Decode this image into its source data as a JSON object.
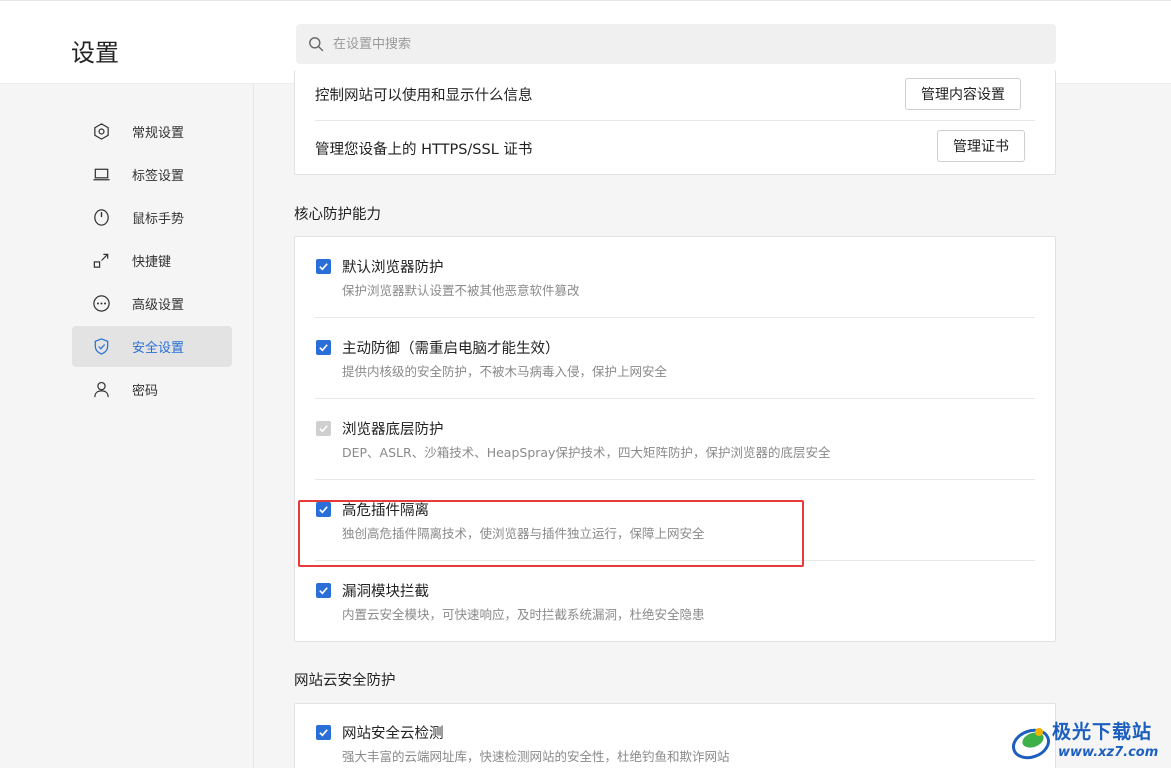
{
  "header": {
    "title": "设置",
    "search_placeholder": "在设置中搜索"
  },
  "sidebar": {
    "items": [
      {
        "label": "常规设置",
        "icon": "hexagon-icon",
        "active": false
      },
      {
        "label": "标签设置",
        "icon": "laptop-icon",
        "active": false
      },
      {
        "label": "鼠标手势",
        "icon": "mouse-icon",
        "active": false
      },
      {
        "label": "快捷键",
        "icon": "shortcut-icon",
        "active": false
      },
      {
        "label": "高级设置",
        "icon": "more-icon",
        "active": false
      },
      {
        "label": "安全设置",
        "icon": "shield-icon",
        "active": true
      },
      {
        "label": "密码",
        "icon": "person-icon",
        "active": false
      }
    ]
  },
  "top_card": {
    "rows": [
      {
        "text": "控制网站可以使用和显示什么信息",
        "button": "管理内容设置"
      },
      {
        "text": "管理您设备上的 HTTPS/SSL 证书",
        "button": "管理证书"
      }
    ]
  },
  "core_protection": {
    "title": "核心防护能力",
    "options": [
      {
        "title": "默认浏览器防护",
        "desc": "保护浏览器默认设置不被其他恶意软件篡改",
        "checked": true,
        "disabled": false
      },
      {
        "title": "主动防御（需重启电脑才能生效）",
        "desc": "提供内核级的安全防护，不被木马病毒入侵，保护上网安全",
        "checked": true,
        "disabled": false
      },
      {
        "title": "浏览器底层防护",
        "desc": "DEP、ASLR、沙箱技术、HeapSpray保护技术，四大矩阵防护，保护浏览器的底层安全",
        "checked": true,
        "disabled": true
      },
      {
        "title": "高危插件隔离",
        "desc": "独创高危插件隔离技术，使浏览器与插件独立运行，保障上网安全",
        "checked": true,
        "disabled": false
      },
      {
        "title": "漏洞模块拦截",
        "desc": "内置云安全模块，可快速响应，及时拦截系统漏洞，杜绝安全隐患",
        "checked": true,
        "disabled": false
      }
    ]
  },
  "web_cloud": {
    "title": "网站云安全防护",
    "options": [
      {
        "title": "网站安全云检测",
        "desc": "强大丰富的云端网址库，快速检测网站的安全性，杜绝钓鱼和欺诈网站",
        "checked": true,
        "disabled": false
      }
    ]
  },
  "watermark": {
    "name": "极光下载站",
    "url": "www.xz7.com"
  },
  "colors": {
    "accent": "#2a6fd8",
    "highlight_box": "#e53b3b",
    "watermark": "#1c5fbf"
  }
}
